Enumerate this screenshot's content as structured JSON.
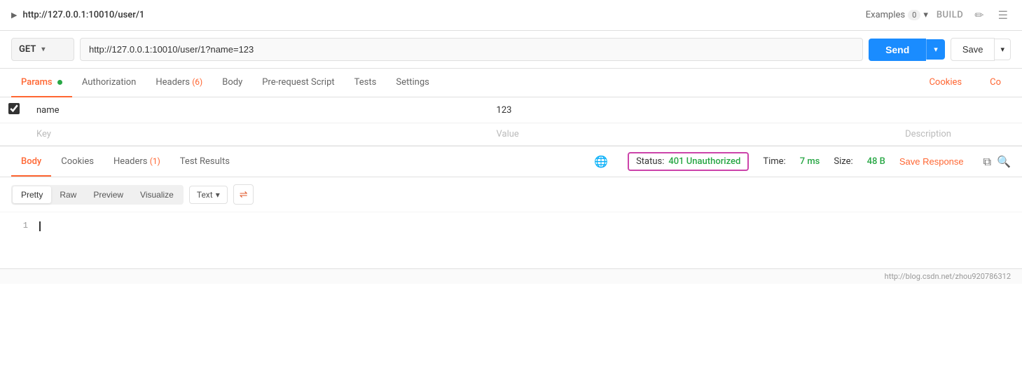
{
  "topbar": {
    "url": "http://127.0.0.1:10010/user/1",
    "examples_label": "Examples",
    "examples_count": "0",
    "build_label": "BUILD",
    "edit_icon": "✏",
    "save_icon": "☰"
  },
  "request": {
    "method": "GET",
    "url": "http://127.0.0.1:10010/user/1?name=123",
    "send_label": "Send",
    "save_label": "Save"
  },
  "tabs": {
    "params_label": "Params",
    "authorization_label": "Authorization",
    "headers_label": "Headers",
    "headers_count": "(6)",
    "body_label": "Body",
    "prerequest_label": "Pre-request Script",
    "tests_label": "Tests",
    "settings_label": "Settings",
    "cookies_label": "Cookies",
    "co_label": "Co"
  },
  "params": {
    "rows": [
      {
        "checked": true,
        "key": "name",
        "value": "123",
        "description": ""
      }
    ],
    "empty_row": {
      "key": "Key",
      "value": "Value",
      "description": "Description"
    }
  },
  "response": {
    "body_tab": "Body",
    "cookies_tab": "Cookies",
    "headers_tab": "Headers",
    "headers_count": "(1)",
    "test_results_tab": "Test Results",
    "status_label": "Status:",
    "status_value": "401 Unauthorized",
    "time_label": "Time:",
    "time_value": "7 ms",
    "size_label": "Size:",
    "size_value": "48 B",
    "save_response_label": "Save Response"
  },
  "format_bar": {
    "pretty_label": "Pretty",
    "raw_label": "Raw",
    "preview_label": "Preview",
    "visualize_label": "Visualize",
    "text_label": "Text"
  },
  "code": {
    "line_1": "1"
  },
  "bottombar": {
    "url": "http://blog.csdn.net/zhou920786312"
  }
}
